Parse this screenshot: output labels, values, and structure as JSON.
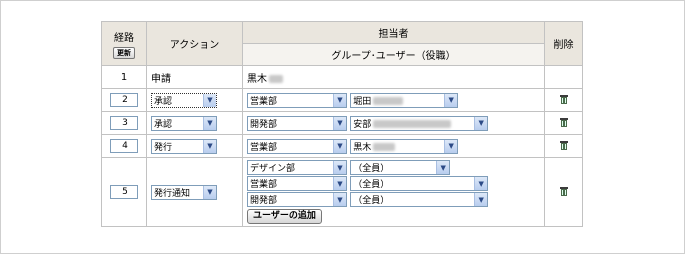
{
  "header": {
    "route_label": "経路",
    "update_label": "更新",
    "action_label": "アクション",
    "assignee_label": "担当者",
    "group_user_label": "グループ･ユーザー（役職）",
    "delete_label": "削除"
  },
  "rows": [
    {
      "num": "1",
      "action": "申請",
      "assignee_name": "黒木"
    },
    {
      "num": "2",
      "action": "承認",
      "group": "営業部",
      "user": "堀田"
    },
    {
      "num": "3",
      "action": "承認",
      "group": "開発部",
      "user": "安部"
    },
    {
      "num": "4",
      "action": "発行",
      "group": "営業部",
      "user": "黒木"
    },
    {
      "num": "5",
      "action": "発行通知",
      "assignees": [
        {
          "group": "デザイン部",
          "user": "（全員）"
        },
        {
          "group": "営業部",
          "user": "（全員）"
        },
        {
          "group": "開発部",
          "user": "（全員）"
        }
      ],
      "add_user_label": "ユーザーの追加"
    }
  ],
  "icons": {
    "delete": "trash-icon",
    "dropdown": "chevron-down-icon"
  },
  "colors": {
    "header_bg": "#eae6de",
    "border": "#c2c2c2",
    "select_border": "#7f9db9"
  }
}
